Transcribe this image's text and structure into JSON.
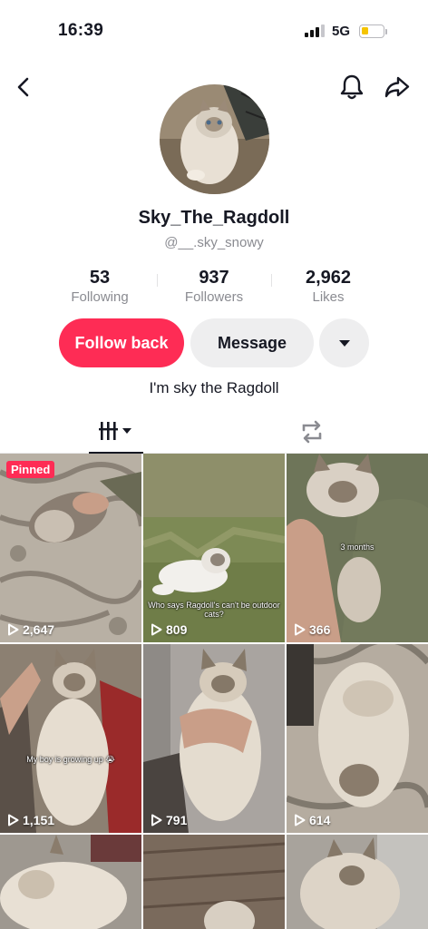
{
  "status": {
    "time": "16:39",
    "network": "5G"
  },
  "profile": {
    "display_name": "Sky_The_Ragdoll",
    "username": "@__.sky_snowy",
    "bio": "I'm sky the Ragdoll"
  },
  "stats": [
    {
      "value": "53",
      "label": "Following"
    },
    {
      "value": "937",
      "label": "Followers"
    },
    {
      "value": "2,962",
      "label": "Likes"
    }
  ],
  "actions": {
    "follow": "Follow back",
    "message": "Message"
  },
  "icons": {
    "back": "chevron-left-icon",
    "bell": "bell-icon",
    "share": "share-arrow-icon",
    "more": "caret-down-icon",
    "videos_tab": "grid-bars-icon",
    "reposts_tab": "repost-icon",
    "play": "play-outline-icon"
  },
  "colors": {
    "accent": "#fe2c55",
    "pinned": "#fe2c55"
  },
  "videos": [
    {
      "views": "2,647",
      "pinned_label": "Pinned",
      "caption": ""
    },
    {
      "views": "809",
      "pinned_label": "",
      "caption": "Who says Ragdoll's can't be outdoor cats?"
    },
    {
      "views": "366",
      "pinned_label": "",
      "caption": "3 months"
    },
    {
      "views": "1,151",
      "pinned_label": "",
      "caption": "My boy is growing up 😭"
    },
    {
      "views": "791",
      "pinned_label": "",
      "caption": ""
    },
    {
      "views": "614",
      "pinned_label": "",
      "caption": ""
    },
    {
      "views": "",
      "pinned_label": "",
      "caption": ""
    },
    {
      "views": "",
      "pinned_label": "",
      "caption": ""
    },
    {
      "views": "",
      "pinned_label": "",
      "caption": ""
    }
  ]
}
